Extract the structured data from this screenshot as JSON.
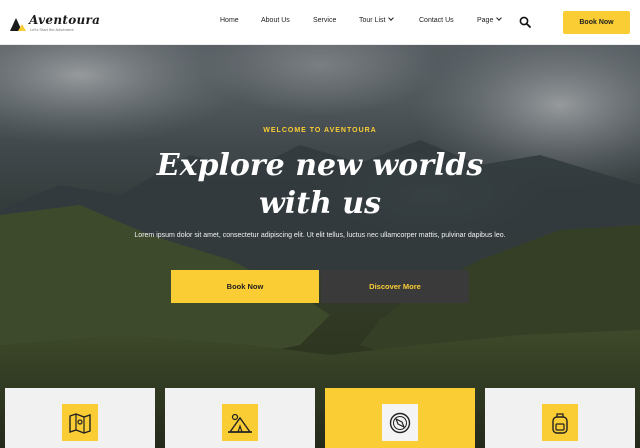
{
  "brand": {
    "name": "Aventoura",
    "tagline": "Let's Start the Adventure"
  },
  "nav": {
    "items": [
      {
        "label": "Home"
      },
      {
        "label": "About Us"
      },
      {
        "label": "Service"
      },
      {
        "label": "Tour List"
      },
      {
        "label": "Contact Us"
      },
      {
        "label": "Page"
      }
    ],
    "book_label": "Book Now",
    "search_icon": "search-icon",
    "accent": "#fbcd35"
  },
  "hero": {
    "eyebrow": "WELCOME TO AVENTOURA",
    "headline_line1": "Explore new worlds",
    "headline_line2": "with us",
    "subtitle": "Lorem ipsum dolor sit amet, consectetur adipiscing elit. Ut elit tellus, luctus nec ullamcorper mattis, pulvinar dapibus leo.",
    "primary_button": "Book Now",
    "secondary_button": "Discover More"
  },
  "features": [
    {
      "icon": "map-icon",
      "active": false
    },
    {
      "icon": "camping-tent-icon",
      "active": false
    },
    {
      "icon": "compass-icon",
      "active": true
    },
    {
      "icon": "backpack-icon",
      "active": false
    }
  ]
}
